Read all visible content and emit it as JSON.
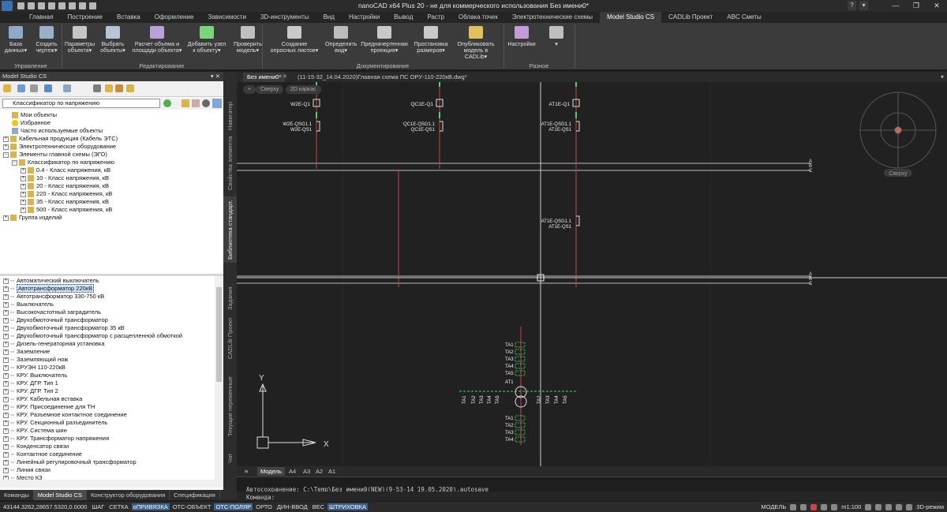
{
  "title_bar": {
    "title": "nanoCAD x64 Plus 20 - не для коммерческого использования Без имени0*"
  },
  "ribbon_tabs": [
    "Главная",
    "Построение",
    "Вставка",
    "Оформление",
    "Зависимости",
    "3D-инструменты",
    "Вид",
    "Настройки",
    "Вывод",
    "Растр",
    "Облака точек",
    "Электротехнические схемы",
    "Model Studio CS",
    "CADLib Проект",
    "ABC Сметы"
  ],
  "active_ribbon_tab": "Model Studio CS",
  "ribbon": {
    "buttons": [
      {
        "label1": "База",
        "label2": "данных▾",
        "color": "#8fa9c9"
      },
      {
        "label1": "Создать",
        "label2": "чертеж▾",
        "color": "#9ab0c8"
      },
      {
        "label1": "Параметры",
        "label2": "объекта▾",
        "color": "#c6c6c6"
      },
      {
        "label1": "Выбрать",
        "label2": "объекты▾",
        "color": "#b7c4d6"
      },
      {
        "label1": "Расчет объема и",
        "label2": "площади объекта▾",
        "color": "#b8a0d8"
      },
      {
        "label1": "Добавить узел",
        "label2": "к объекту▾",
        "color": "#7ad67a"
      },
      {
        "label1": "Проверить",
        "label2": "модель▾",
        "color": "#c0c0c0"
      },
      {
        "label1": "Создание",
        "label2": "опросных листов▾",
        "color": "#c9c9c9"
      },
      {
        "label1": "Определить",
        "label2": "вид▾",
        "color": "#bcbcbc"
      },
      {
        "label1": "Предначертенная",
        "label2": "проекция▾",
        "color": "#c9c9c9"
      },
      {
        "label1": "Простановка",
        "label2": "размеров▾",
        "color": "#c9c9c9"
      },
      {
        "label1": "Опубликовать",
        "label2": "модель в CADLib▾",
        "color": "#e0c15a"
      },
      {
        "label1": "Настройки",
        "label2": "",
        "color": "#c49ad9"
      }
    ],
    "groups": [
      "Управление",
      "Редактирование",
      "Документирование",
      "Разное"
    ]
  },
  "left_panel": {
    "header": "Model Studio CS",
    "header_ctrls": "▾ ✕",
    "combo_value": "Классификатор по напряжению",
    "tree": [
      {
        "indent": 0,
        "pm": "",
        "icon": "folder-icon",
        "label": "Мои объекты"
      },
      {
        "indent": 0,
        "pm": "",
        "icon": "star-icon",
        "label": "Избранное"
      },
      {
        "indent": 0,
        "pm": "",
        "icon": "doc-icon",
        "label": "Часто используемые объекты"
      },
      {
        "indent": 0,
        "pm": "+",
        "icon": "folder-icon",
        "label": "Кабельная продукция (Кабель ЭТС)"
      },
      {
        "indent": 0,
        "pm": "+",
        "icon": "folder-icon",
        "label": "Электротехническое оборудование"
      },
      {
        "indent": 0,
        "pm": "−",
        "icon": "folder-icon",
        "label": "Элементы главной схемы (ЭГО)"
      },
      {
        "indent": 1,
        "pm": "−",
        "icon": "folder-icon",
        "label": "Классификатор по напряжению"
      },
      {
        "indent": 2,
        "pm": "+",
        "icon": "folder-icon",
        "label": "0.4 - Класс напряжения, кВ"
      },
      {
        "indent": 2,
        "pm": "+",
        "icon": "folder-icon",
        "label": "10 - Класс напряжения, кВ"
      },
      {
        "indent": 2,
        "pm": "+",
        "icon": "folder-icon",
        "label": "20 - Класс напряжения, кВ"
      },
      {
        "indent": 2,
        "pm": "+",
        "icon": "folder-icon",
        "label": "220 - Класс напряжения, кВ"
      },
      {
        "indent": 2,
        "pm": "+",
        "icon": "folder-icon",
        "label": "35 - Класс напряжения, кВ"
      },
      {
        "indent": 2,
        "pm": "+",
        "icon": "folder-icon",
        "label": "500 - Класс напряжения, кВ"
      },
      {
        "indent": 0,
        "pm": "+",
        "icon": "folder-icon",
        "label": "Группа изделий"
      }
    ],
    "list": [
      "Автоматический выключатель",
      "Автотрансформатор 220кВ",
      "Автотрансформатор 330-750 кВ",
      "Выключатель",
      "Высокочастотный заградитель",
      "Двухобмоточный трансформатор",
      "Двухобмоточный трансформатор 35 кВ",
      "Двухобмоточный трансформатор с расщепленной обмоткой",
      "Дизель-генераторная установка",
      "Заземление",
      "Заземляющий нож",
      "КРУЭН 110-220кВ",
      "КРУ. Выключатель",
      "КРУ. ДГР. Тип 1",
      "КРУ. ДГР. Тип 2",
      "КРУ. Кабельная вставка",
      "КРУ. Присоединение для ТН",
      "КРУ. Разъемное контактное соединение",
      "КРУ. Секционный разъединитель",
      "КРУ. Система шин",
      "КРУ. Трансформатор напряжения",
      "Конденсатор связи",
      "Контактное соединение",
      "Линейный регулировочный трансформатор",
      "Линия связи",
      "Место КЗ"
    ],
    "selected_index": 1,
    "bottom_tabs": [
      "Команды",
      "Model Studio CS",
      "Конструктор оборудования",
      "Спецификация"
    ],
    "active_bottom_tab": "Model Studio CS"
  },
  "side_tabs": [
    "Навигатор",
    "Свойства элемента",
    "Библиотека стандарт.",
    "Задания",
    "CADLib Проект",
    "Текущие переменные",
    "Чат"
  ],
  "active_side_tab": "Библиотека стандарт.",
  "doc_tabs": [
    "Без имени0*",
    "(11-15-32_14.04.2020)Главная схема ПС ОРУ-110-220кВ.dwg*"
  ],
  "viewport_buttons": [
    "+",
    "Сверху",
    "2D каркас"
  ],
  "drawing": {
    "top_labels_left": [
      "W2E-Q1",
      "QC1E-Q1",
      "AT1E-Q1"
    ],
    "ground_labels": [
      [
        "W2E-QSG1.1",
        "W2E-QS1"
      ],
      [
        "QC1E-QSG1.1",
        "QC1E-QS1"
      ],
      [
        "AT1E-QSG1.1",
        "AT1E-QS1"
      ]
    ],
    "bus_letters": [
      "A",
      "B",
      "C"
    ],
    "ta_labels": [
      "TA1",
      "TA2",
      "TA3",
      "TA4",
      "TA5"
    ],
    "at_label": "AT1",
    "axis_y": "Y",
    "axis_x": "X",
    "viewcube_label": "Сверху"
  },
  "layout_tabs": [
    "Модель",
    "A4",
    "A3",
    "A2",
    "A1"
  ],
  "active_layout_tab": "Модель",
  "command_line": {
    "line1": "Автосохранение: C:\\Temp\\Без имени0(NEW)(9-53-14_19.05.2020).autosave",
    "line2": "Команда:"
  },
  "status_bar": {
    "coords": "43144.3262,28657.5320,0.0000",
    "toggles": [
      {
        "label": "ШАГ",
        "on": false
      },
      {
        "label": "СЕТКА",
        "on": false
      },
      {
        "label": "оПРИВЯЗКА",
        "on": true
      },
      {
        "label": "ОТС-ОБЪЕКТ",
        "on": false
      },
      {
        "label": "ОТС-ПОЛЯР",
        "on": true
      },
      {
        "label": "ОРТО",
        "on": false
      },
      {
        "label": "ДИН-ВВОД",
        "on": false
      },
      {
        "label": "ВЕС",
        "on": false
      },
      {
        "label": "ШТРИХОВКА",
        "on": true
      }
    ],
    "model_label": "МОДЕЛЬ",
    "scale": "m1:100",
    "mode_3d": "3D-режим"
  }
}
